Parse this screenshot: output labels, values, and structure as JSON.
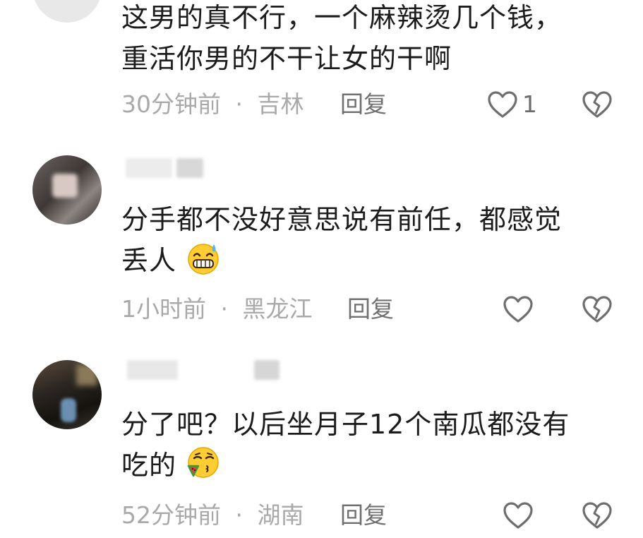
{
  "comments": [
    {
      "text_lines": [
        "这男的真不行，一个麻辣烫几个钱，",
        "重活你男的不干让女的干啊"
      ],
      "time": "30分钟前",
      "location": "吉林",
      "separator": "·",
      "reply_label": "回复",
      "like_count": "1",
      "icons": [
        "heart-icon",
        "broken-heart-icon"
      ]
    },
    {
      "text_lines": [
        "分手都不没好意思说有前任，都感觉",
        "丢人"
      ],
      "emoji": "grinning-sweat-emoji",
      "time": "1小时前",
      "location": "黑龙江",
      "separator": "·",
      "reply_label": "回复",
      "icons": [
        "heart-icon",
        "broken-heart-icon"
      ]
    },
    {
      "text_lines": [
        "分了吧？以后坐月子12个南瓜都没有",
        "吃的"
      ],
      "emoji": "smirking-watermelon-emoji",
      "time": "52分钟前",
      "location": "湖南",
      "separator": "·",
      "reply_label": "回复",
      "icons": [
        "heart-icon",
        "broken-heart-icon"
      ]
    }
  ],
  "colors": {
    "text": "#1c1c1c",
    "meta": "#a9a9a9",
    "reply": "#707070",
    "icon": "#6e6e6e"
  }
}
